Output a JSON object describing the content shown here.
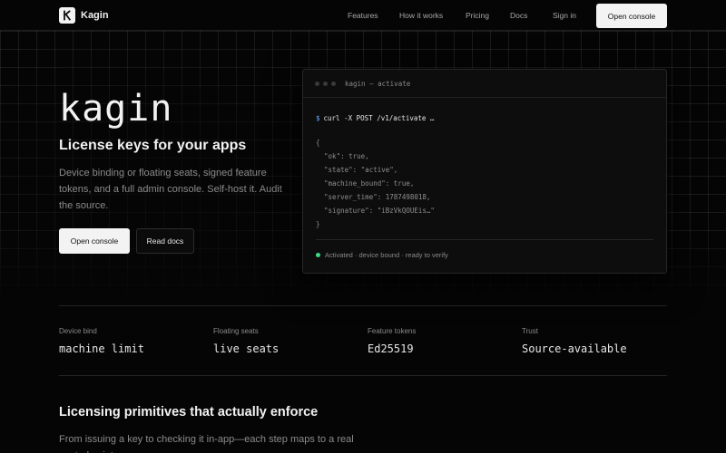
{
  "header": {
    "logo_text": "Kagin",
    "nav": [
      "Features",
      "How it works",
      "Pricing",
      "Docs"
    ],
    "sign_in": "Sign in",
    "cta": "Open console"
  },
  "hero": {
    "title": "kagin",
    "subtitle": "License keys for your apps",
    "description": "Device binding or floating seats, signed feature tokens, and a full admin console. Self-host it. Audit the source.",
    "primary_button": "Open console",
    "secondary_button": "Read docs"
  },
  "terminal": {
    "title": "kagin — activate",
    "prompt": "$",
    "command": "curl -X POST /v1/activate …",
    "response_lines": [
      "{",
      "  \"ok\": true,",
      "  \"state\": \"active\",",
      "  \"machine_bound\": true,",
      "  \"server_time\": 1787498018,",
      "  \"signature\": \"iBzVkQOUEis…\"",
      "}"
    ],
    "status": "Activated · device bound · ready to verify"
  },
  "stats": [
    {
      "label": "Device bind",
      "value": "machine limit"
    },
    {
      "label": "Floating seats",
      "value": "live seats"
    },
    {
      "label": "Feature tokens",
      "value": "Ed25519"
    },
    {
      "label": "Trust",
      "value": "Source-available"
    }
  ],
  "section": {
    "title": "Licensing primitives that actually enforce",
    "description": "From issuing a key to checking it in-app—each step maps to a real control point."
  },
  "colors": {
    "background": "#050505",
    "accent_prompt": "#6ea8ff",
    "status_ok": "#3ddc84"
  }
}
